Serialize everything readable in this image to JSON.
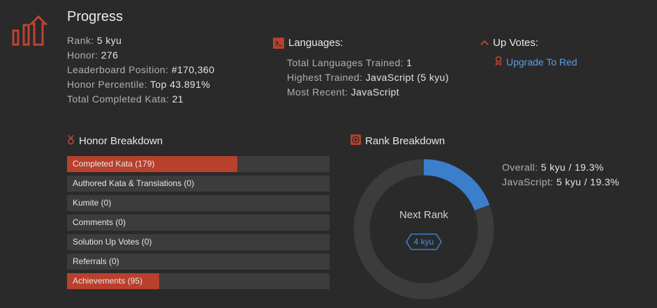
{
  "progress": {
    "icon": "bar-chart-up-icon",
    "title": "Progress",
    "stats": [
      {
        "key": "Rank:",
        "value": "5 kyu"
      },
      {
        "key": "Honor:",
        "value": "276"
      },
      {
        "key": "Leaderboard Position:",
        "value": "#170,360"
      },
      {
        "key": "Honor Percentile:",
        "value": "Top 43.891%"
      },
      {
        "key": "Total Completed Kata:",
        "value": "21"
      }
    ]
  },
  "languages": {
    "icon": "terminal-icon",
    "title": "Languages:",
    "stats": [
      {
        "key": "Total Languages Trained:",
        "value": "1"
      },
      {
        "key": "Highest Trained:",
        "value": "JavaScript (5 kyu)"
      },
      {
        "key": "Most Recent:",
        "value": "JavaScript"
      }
    ]
  },
  "up_votes": {
    "icon": "chevron-up-icon",
    "title": "Up Votes:",
    "link_icon": "ribbon-icon",
    "link": "Upgrade To Red"
  },
  "honor_breakdown": {
    "icon": "medal-icon",
    "title": "Honor Breakdown",
    "bars": [
      {
        "label": "Completed Kata (179)",
        "fraction": 0.65
      },
      {
        "label": "Authored Kata & Translations (0)",
        "fraction": 0
      },
      {
        "label": "Kumite (0)",
        "fraction": 0
      },
      {
        "label": "Comments (0)",
        "fraction": 0
      },
      {
        "label": "Solution Up Votes (0)",
        "fraction": 0
      },
      {
        "label": "Referrals (0)",
        "fraction": 0
      },
      {
        "label": "Achievements (95)",
        "fraction": 0.35
      }
    ]
  },
  "rank_breakdown": {
    "icon": "target-icon",
    "title": "Rank Breakdown",
    "progress_fraction": 0.193,
    "next_rank_label": "Next Rank",
    "next_rank_badge": "4 kyu",
    "stats": [
      {
        "key": "Overall:",
        "value": "5 kyu / 19.3%"
      },
      {
        "key": "JavaScript:",
        "value": "5 kyu / 19.3%"
      }
    ]
  },
  "colors": {
    "background": "#2a2a2b",
    "accent_red": "#b8402c",
    "accent_blue": "#3b7fcc",
    "track": "#3c3c3d"
  }
}
